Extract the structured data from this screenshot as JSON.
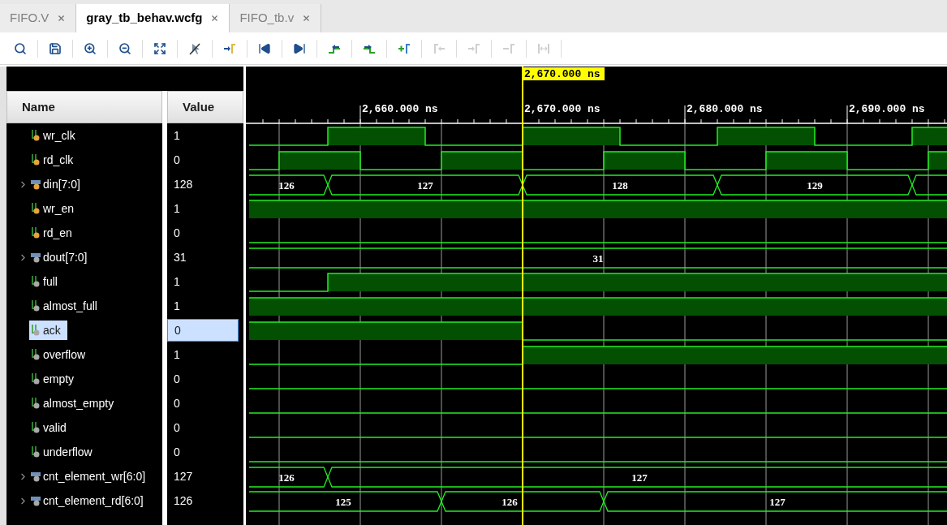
{
  "tabs": [
    {
      "label": "FIFO.V",
      "selected": false
    },
    {
      "label": "gray_tb_behav.wcfg",
      "selected": true
    },
    {
      "label": "FIFO_tb.v",
      "selected": false
    }
  ],
  "toolbar": [
    {
      "disabled": false
    },
    {
      "disabled": false
    },
    {
      "disabled": false
    },
    {
      "disabled": false
    },
    {
      "disabled": false
    },
    {
      "disabled": false
    },
    {
      "disabled": false
    },
    {
      "disabled": false
    },
    {
      "disabled": false
    },
    {
      "disabled": false
    },
    {
      "disabled": false
    },
    {
      "disabled": false
    },
    {
      "disabled": true
    },
    {
      "disabled": true
    },
    {
      "disabled": true
    },
    {
      "disabled": true
    }
  ],
  "columns": {
    "name": "Name",
    "value": "Value"
  },
  "timeline": {
    "cursor_label": "2,670.000 ns",
    "ticks": [
      "2,660.000 ns",
      "2,670.000 ns",
      "2,680.000 ns",
      "2,690.000 ns"
    ]
  },
  "signals": [
    {
      "name": "wr_clk",
      "value": "1",
      "kind": "bit",
      "color": "#e8a33c",
      "selected": false
    },
    {
      "name": "rd_clk",
      "value": "0",
      "kind": "bit",
      "color": "#e8a33c",
      "selected": false
    },
    {
      "name": "din[7:0]",
      "value": "128",
      "kind": "bus",
      "color": "#e8a33c",
      "selected": false,
      "segments": [
        "126",
        "127",
        "128",
        "129"
      ]
    },
    {
      "name": "wr_en",
      "value": "1",
      "kind": "bit",
      "color": "#e8a33c",
      "selected": false
    },
    {
      "name": "rd_en",
      "value": "0",
      "kind": "bit",
      "color": "#e8a33c",
      "selected": false
    },
    {
      "name": "dout[7:0]",
      "value": "31",
      "kind": "bus",
      "color": "#a8a8a8",
      "selected": false,
      "segments": [
        "31"
      ]
    },
    {
      "name": "full",
      "value": "1",
      "kind": "bit",
      "color": "#a8a8a8",
      "selected": false
    },
    {
      "name": "almost_full",
      "value": "1",
      "kind": "bit",
      "color": "#a8a8a8",
      "selected": false
    },
    {
      "name": "ack",
      "value": "0",
      "kind": "bit",
      "color": "#a8a8a8",
      "selected": true
    },
    {
      "name": "overflow",
      "value": "1",
      "kind": "bit",
      "color": "#a8a8a8",
      "selected": false
    },
    {
      "name": "empty",
      "value": "0",
      "kind": "bit",
      "color": "#a8a8a8",
      "selected": false
    },
    {
      "name": "almost_empty",
      "value": "0",
      "kind": "bit",
      "color": "#a8a8a8",
      "selected": false
    },
    {
      "name": "valid",
      "value": "0",
      "kind": "bit",
      "color": "#a8a8a8",
      "selected": false
    },
    {
      "name": "underflow",
      "value": "0",
      "kind": "bit",
      "color": "#a8a8a8",
      "selected": false
    },
    {
      "name": "cnt_element_wr[6:0]",
      "value": "127",
      "kind": "bus",
      "color": "#a8a8a8",
      "selected": false,
      "segments": [
        "126",
        "127"
      ]
    },
    {
      "name": "cnt_element_rd[6:0]",
      "value": "126",
      "kind": "bus",
      "color": "#a8a8a8",
      "selected": false,
      "segments": [
        "125",
        "126",
        "127"
      ]
    }
  ]
}
